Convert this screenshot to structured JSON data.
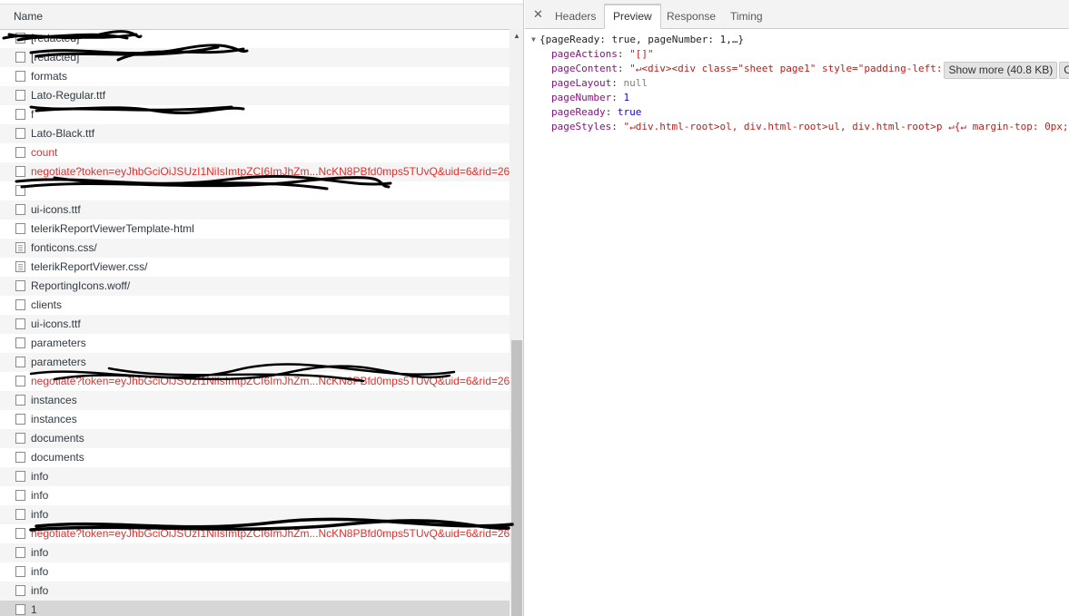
{
  "network": {
    "column_header": "Name",
    "requests": [
      {
        "label": "[redacted]",
        "error": false,
        "doc": false
      },
      {
        "label": "[redacted]",
        "error": false,
        "doc": false
      },
      {
        "label": "formats",
        "error": false,
        "doc": false
      },
      {
        "label": "Lato-Regular.ttf",
        "error": false,
        "doc": false
      },
      {
        "label": "f",
        "error": false,
        "doc": false
      },
      {
        "label": "Lato-Black.ttf",
        "error": false,
        "doc": false
      },
      {
        "label": "count",
        "error": true,
        "doc": false
      },
      {
        "label": "negotiate?token=eyJhbGciOiJSUzI1NiIsImtpZCI6ImJhZm...NcKN8PBfd0mps5TUvQ&uid=6&rid=26&",
        "error": true,
        "doc": false
      },
      {
        "label": "",
        "error": false,
        "doc": false
      },
      {
        "label": "ui-icons.ttf",
        "error": false,
        "doc": false
      },
      {
        "label": "telerikReportViewerTemplate-html",
        "error": false,
        "doc": false
      },
      {
        "label": "fonticons.css/",
        "error": false,
        "doc": true
      },
      {
        "label": "telerikReportViewer.css/",
        "error": false,
        "doc": true
      },
      {
        "label": "ReportingIcons.woff/",
        "error": false,
        "doc": false
      },
      {
        "label": "clients",
        "error": false,
        "doc": false
      },
      {
        "label": "ui-icons.ttf",
        "error": false,
        "doc": false
      },
      {
        "label": "parameters",
        "error": false,
        "doc": false
      },
      {
        "label": "parameters",
        "error": false,
        "doc": false
      },
      {
        "label": "negotiate?token=eyJhbGciOiJSUzI1NiIsImtpZCI6ImJhZm...NcKN8PBfd0mps5TUvQ&uid=6&rid=26&",
        "error": true,
        "doc": false
      },
      {
        "label": "instances",
        "error": false,
        "doc": false
      },
      {
        "label": "instances",
        "error": false,
        "doc": false
      },
      {
        "label": "documents",
        "error": false,
        "doc": false
      },
      {
        "label": "documents",
        "error": false,
        "doc": false
      },
      {
        "label": "info",
        "error": false,
        "doc": false
      },
      {
        "label": "info",
        "error": false,
        "doc": false
      },
      {
        "label": "info",
        "error": false,
        "doc": false
      },
      {
        "label": "negotiate?token=eyJhbGciOiJSUzI1NiIsImtpZCI6ImJhZm...NcKN8PBfd0mps5TUvQ&uid=6&rid=26&",
        "error": true,
        "doc": false
      },
      {
        "label": "info",
        "error": false,
        "doc": false
      },
      {
        "label": "info",
        "error": false,
        "doc": false
      },
      {
        "label": "info",
        "error": false,
        "doc": false
      },
      {
        "label": "1",
        "error": false,
        "doc": false,
        "selected": true
      }
    ]
  },
  "details": {
    "close_glyph": "✕",
    "tabs": [
      "Headers",
      "Preview",
      "Response",
      "Timing"
    ],
    "active_tab": "Preview",
    "preview": {
      "summary": "{pageReady: true, pageNumber: 1,…}",
      "props": [
        {
          "key": "pageActions",
          "value": "\"[]\"",
          "type": "str"
        },
        {
          "key": "pageContent",
          "value": "\"↵<div><div class=\"sheet page1\" style=\"padding-left:",
          "type": "str",
          "show_more": "Show more (40.8 KB)",
          "copy": "Copy"
        },
        {
          "key": "pageLayout",
          "value": "null",
          "type": "nul"
        },
        {
          "key": "pageNumber",
          "value": "1",
          "type": "num"
        },
        {
          "key": "pageReady",
          "value": "true",
          "type": "bool"
        },
        {
          "key": "pageStyles",
          "value": "\"↵div.html-root>ol, div.html-root>ul, div.html-root>p ↵{↵   margin-top: 0px;",
          "type": "str"
        }
      ]
    }
  },
  "colors": {
    "error_text": "#e0302d",
    "json_key": "#881280",
    "json_string": "#c41a16",
    "json_number": "#1c00cf"
  }
}
